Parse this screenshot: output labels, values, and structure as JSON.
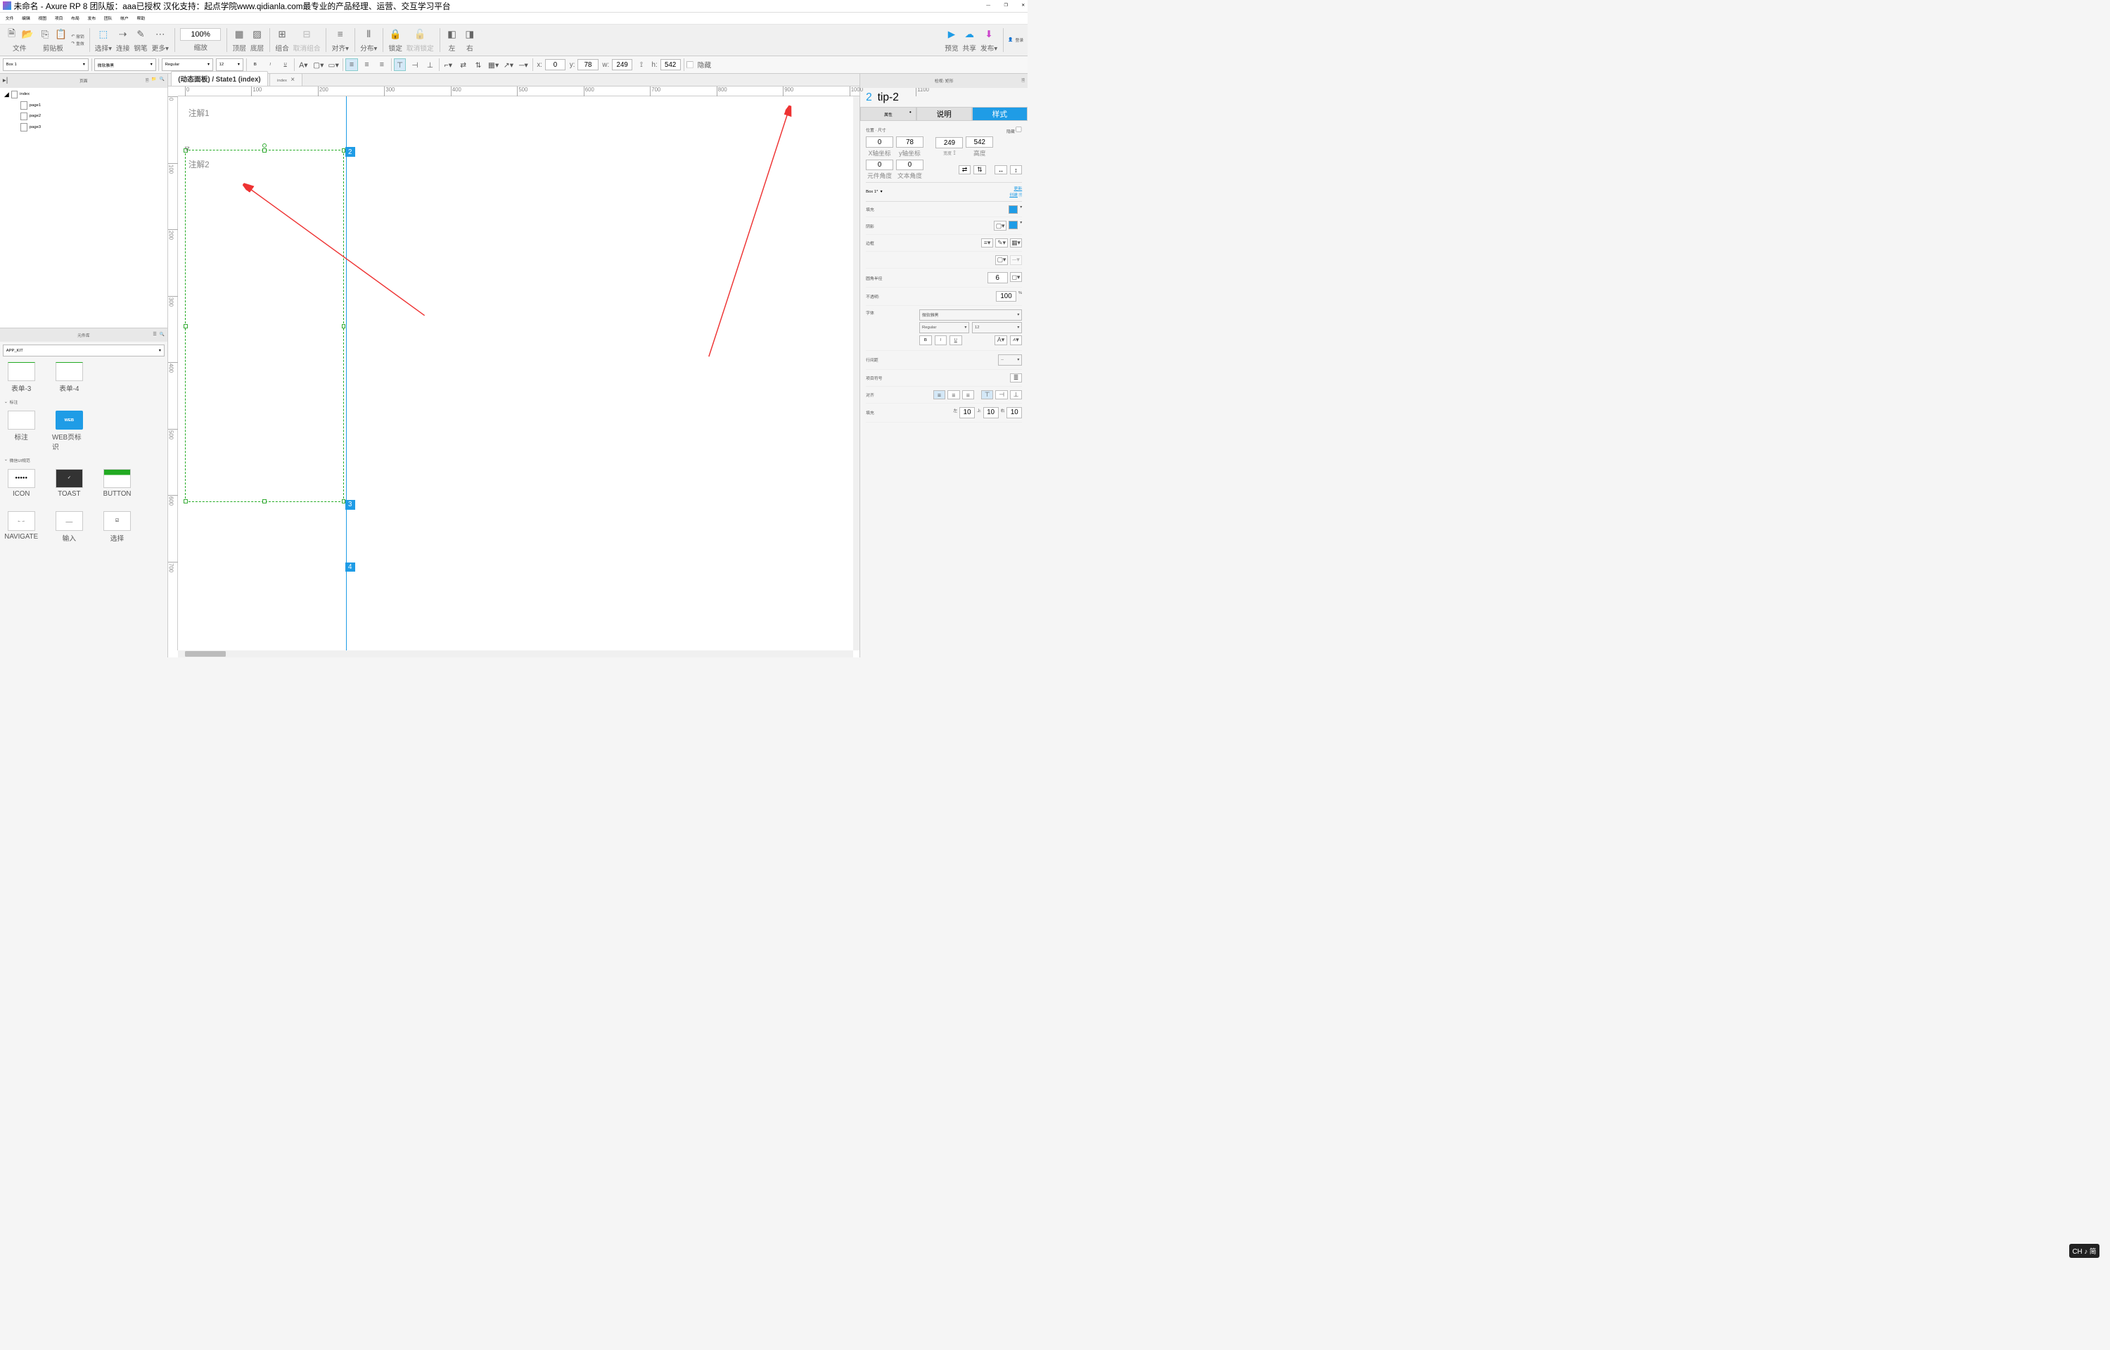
{
  "window": {
    "title": "未命名 - Axure RP 8 团队版：aaa已授权 汉化支持：起点学院www.qidianla.com最专业的产品经理、运营、交互学习平台",
    "controls": {
      "minimize": "—",
      "maximize": "❐",
      "close": "✕"
    }
  },
  "menu": [
    "文件",
    "编辑",
    "视图",
    "项目",
    "布局",
    "发布",
    "团队",
    "帐户",
    "帮助"
  ],
  "toolbar": {
    "file": "文件",
    "clipboard": "剪贴板",
    "undo": "撤销",
    "redo": "重做",
    "select": "选择▾",
    "connect": "连接",
    "pen": "钢笔",
    "more": "更多▾",
    "zoom_value": "100%",
    "zoom": "缩放",
    "front": "顶层",
    "back": "底层",
    "group": "组合",
    "ungroup": "取消组合",
    "align": "对齐▾",
    "distribute": "分布▾",
    "lock": "锁定",
    "unlock": "取消锁定",
    "left": "左",
    "right": "右",
    "preview": "预览",
    "share": "共享",
    "publish": "发布▾",
    "login": "登录"
  },
  "formatbar": {
    "style_name": "Box 1",
    "font": "微软雅黑",
    "weight": "Regular",
    "size": "12",
    "xlabel": "x:",
    "x": "0",
    "ylabel": "y:",
    "y": "78",
    "wlabel": "w:",
    "w": "249",
    "hlabel": "h:",
    "h": "542",
    "hidden_label": "隐藏"
  },
  "pages": {
    "title": "页面",
    "root": "index",
    "children": [
      "page1",
      "page2",
      "page3"
    ]
  },
  "library": {
    "title": "元件库",
    "dropdown": "APP_KIT",
    "row1": [
      {
        "label": "表单-3"
      },
      {
        "label": "表单-4"
      }
    ],
    "section1": "标注",
    "s1items": [
      {
        "label": "标注",
        "thumb": ""
      },
      {
        "label": "WEB页标识",
        "thumb": "WEB",
        "blue": true
      }
    ],
    "section2": "微信UI规范",
    "s2items": [
      {
        "label": "ICON"
      },
      {
        "label": "TOAST"
      },
      {
        "label": "BUTTON"
      },
      {
        "label": "NAVIGATE"
      },
      {
        "label": "输入"
      },
      {
        "label": "选择"
      }
    ]
  },
  "canvas": {
    "tab_active": "(动态面板) / State1 (index)",
    "tab_other": "index",
    "annotations": {
      "ann1": "注解1",
      "ann2": "注解2"
    },
    "badges": [
      "2",
      "3",
      "4"
    ],
    "ruler_h": [
      0,
      100,
      200,
      300,
      400,
      500,
      600,
      700,
      800,
      900,
      1000,
      1100
    ],
    "ruler_v": [
      0,
      100,
      200,
      300,
      400,
      500,
      600,
      700
    ]
  },
  "inspector": {
    "header": "检视: 矩形",
    "badge_num": "2",
    "element_name": "tip-2",
    "tabs": {
      "props": "属性",
      "notes": "说明",
      "style": "样式"
    },
    "pos_size": "位置 · 尺寸",
    "hidden": "隐藏",
    "x": "0",
    "y": "78",
    "w": "249",
    "h": "542",
    "x_label": "X轴坐标",
    "y_label": "y轴坐标",
    "w_label": "宽度",
    "h_label": "高度",
    "rotation": "0",
    "text_rotation": "0",
    "rotation_label": "元件角度",
    "text_rot_label": "文本角度",
    "style_name": "Box 1*",
    "update_link": "更新",
    "create_link": "创建",
    "fill": "填充",
    "shadow": "阴影",
    "border": "边框",
    "radius": "圆角半径",
    "radius_val": "6",
    "opacity": "不透明:",
    "opacity_val": "100",
    "percent": "%",
    "font_section": "字体",
    "font": "微软雅黑",
    "weight": "Regular",
    "size": "12",
    "line_height": "行间距",
    "bullet": "项目符号",
    "align_label": "对齐",
    "padding": "填充",
    "pad_left_l": "左",
    "pad_left": "10",
    "pad_top_l": "上",
    "pad_top": "10",
    "pad_right_l": "右",
    "pad_right": "10"
  },
  "ime": "CH ♪ 简"
}
